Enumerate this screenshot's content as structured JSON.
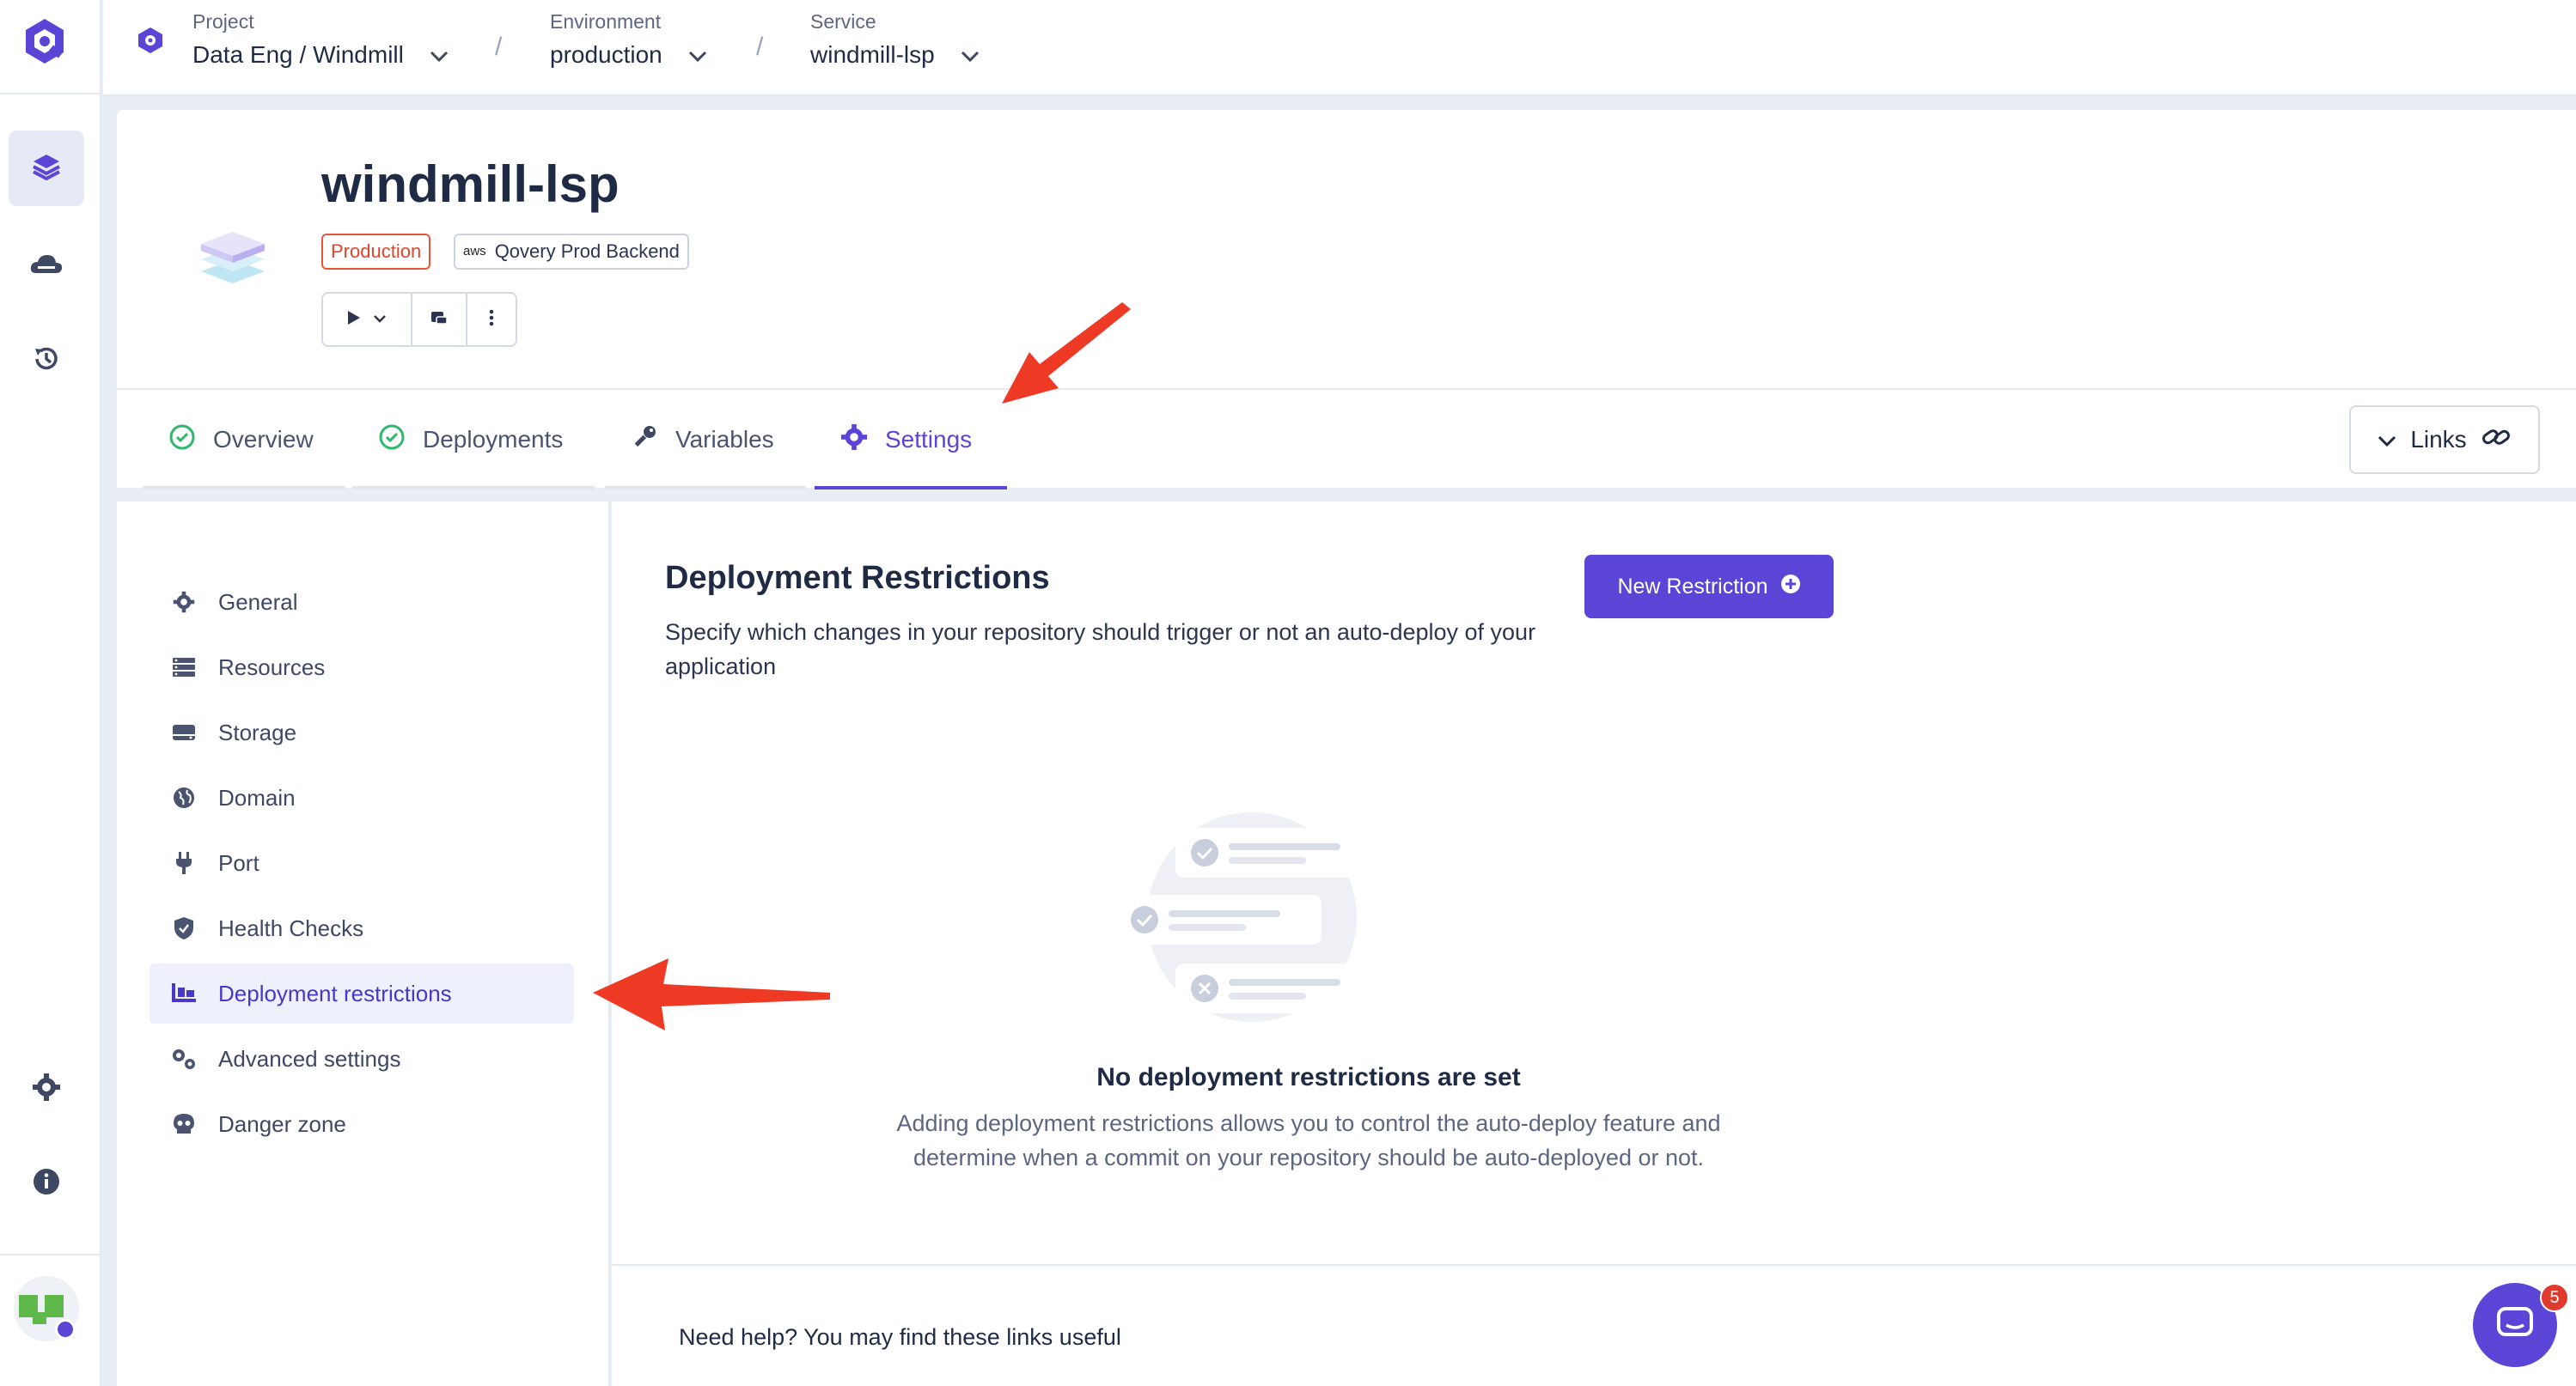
{
  "breadcrumb": {
    "project": {
      "label": "Project",
      "value": "Data Eng / Windmill"
    },
    "environment": {
      "label": "Environment",
      "value": "production"
    },
    "service": {
      "label": "Service",
      "value": "windmill-lsp"
    },
    "separator": "/"
  },
  "service": {
    "title": "windmill-lsp",
    "env_badge": "Production",
    "cluster_provider": "aws",
    "cluster_badge": "Qovery Prod Backend"
  },
  "tabs": [
    {
      "label": "Overview"
    },
    {
      "label": "Deployments"
    },
    {
      "label": "Variables"
    },
    {
      "label": "Settings"
    }
  ],
  "links_button": "Links",
  "settings_nav": [
    {
      "label": "General",
      "icon": "gear-icon"
    },
    {
      "label": "Resources",
      "icon": "server-icon"
    },
    {
      "label": "Storage",
      "icon": "hdd-icon"
    },
    {
      "label": "Domain",
      "icon": "globe-icon"
    },
    {
      "label": "Port",
      "icon": "plug-icon"
    },
    {
      "label": "Health Checks",
      "icon": "shield-icon"
    },
    {
      "label": "Deployment restrictions",
      "icon": "truck-ramp-icon"
    },
    {
      "label": "Advanced settings",
      "icon": "gears-icon"
    },
    {
      "label": "Danger zone",
      "icon": "skull-icon"
    }
  ],
  "main": {
    "title": "Deployment Restrictions",
    "description": "Specify which changes in your repository should trigger or not an auto-deploy of your application",
    "new_button": "New Restriction",
    "empty_title": "No deployment restrictions are set",
    "empty_description": "Adding deployment restrictions allows you to control the auto-deploy feature and determine when a commit on your repository should be auto-deployed or not.",
    "help_text": "Need help? You may find these links useful"
  },
  "chat": {
    "unread_count": "5"
  },
  "colors": {
    "accent": "#5b45d6",
    "production_badge": "#e0442a",
    "annotation_arrow": "#ee3a24",
    "success": "#2fb86b"
  }
}
